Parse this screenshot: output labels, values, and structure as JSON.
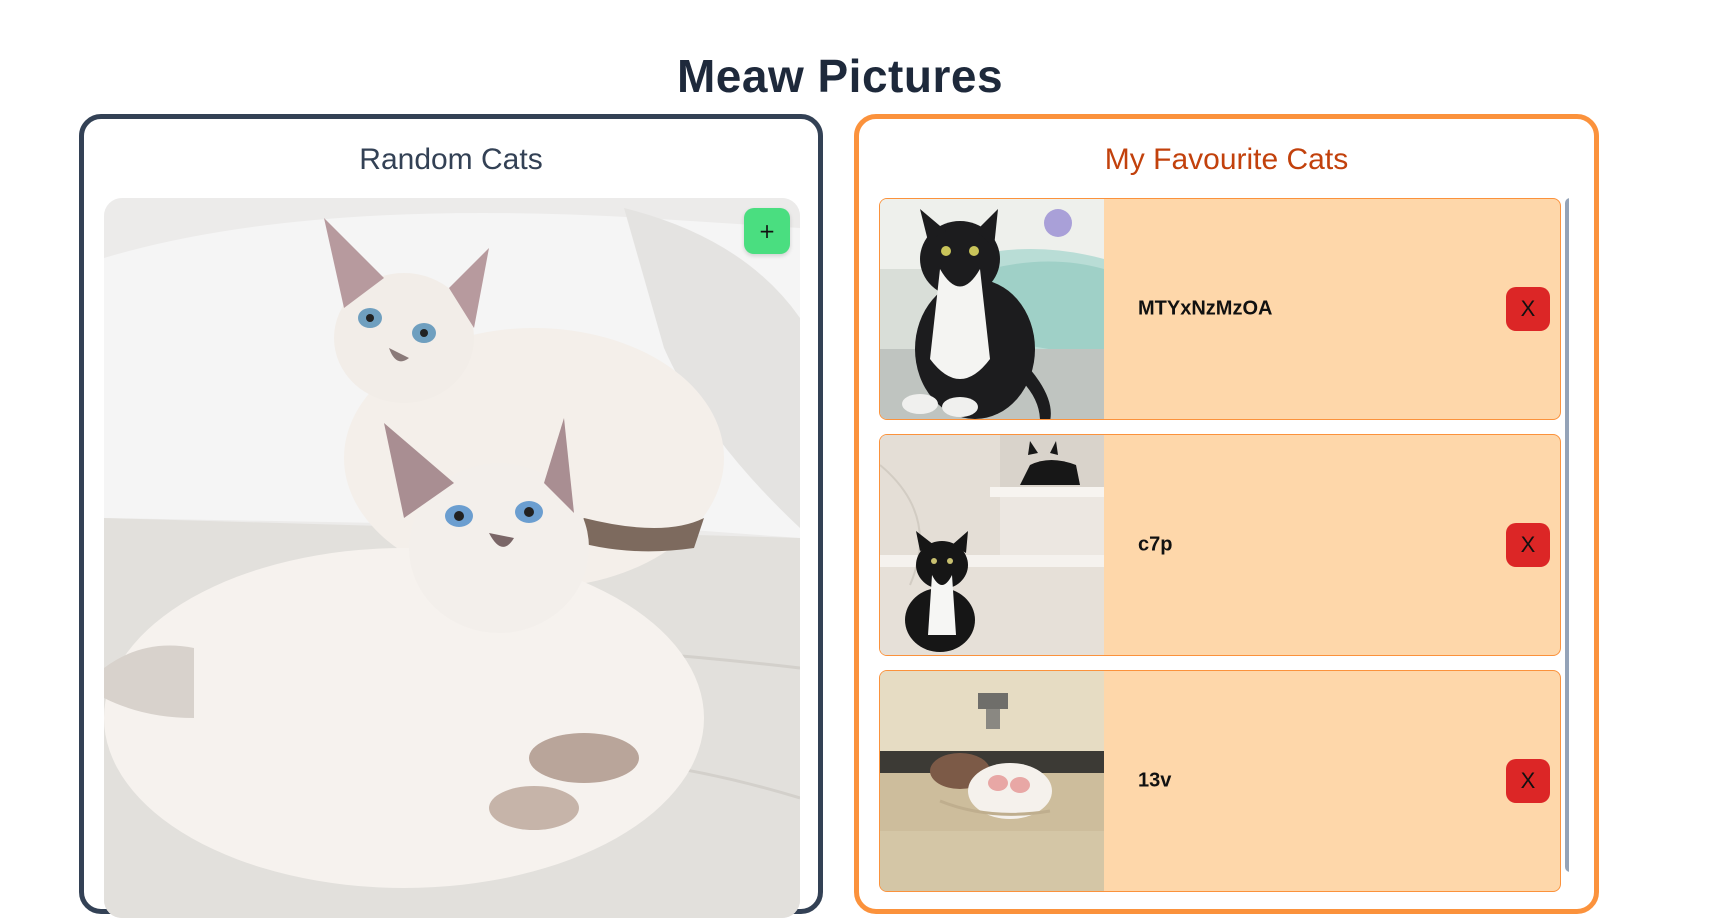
{
  "page": {
    "title": "Meaw Pictures"
  },
  "random_panel": {
    "title": "Random Cats",
    "image_alt": "two siamese kittens on a white sofa",
    "add_label": "+"
  },
  "favourites_panel": {
    "title": "My Favourite Cats",
    "items": [
      {
        "id": "MTYxNzMzOA",
        "remove_label": "X",
        "image_alt": "black and white cat sitting in bathtub"
      },
      {
        "id": "c7p",
        "remove_label": "X",
        "image_alt": "black and white kittens on marble steps"
      },
      {
        "id": "13v",
        "remove_label": "X",
        "image_alt": "kitten with toy mouse on floor"
      }
    ]
  },
  "colors": {
    "random_border": "#334155",
    "favourite_border": "#fb923c",
    "favourite_title": "#c2410c",
    "favourite_card": "#fed7aa",
    "add_button": "#4ade80",
    "remove_button": "#dc2626",
    "scrollbar": "#94a3b8"
  }
}
